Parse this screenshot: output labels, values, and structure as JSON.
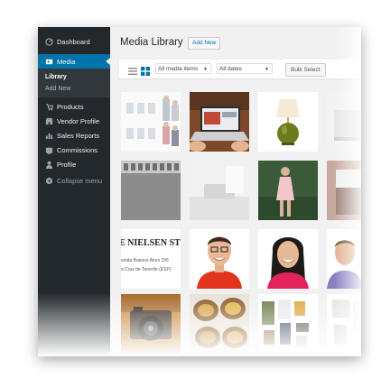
{
  "sidebar": {
    "items": [
      {
        "label": "Dashboard",
        "icon": "dashboard-icon"
      },
      {
        "label": "Media",
        "icon": "media-icon"
      },
      {
        "label": "Products",
        "icon": "products-icon"
      },
      {
        "label": "Vendor Profile",
        "icon": "vendor-profile-icon"
      },
      {
        "label": "Sales Reports",
        "icon": "sales-reports-icon"
      },
      {
        "label": "Commissions",
        "icon": "commissions-icon"
      },
      {
        "label": "Profile",
        "icon": "profile-icon"
      },
      {
        "label": "Collapse menu",
        "icon": "collapse-icon"
      }
    ],
    "submenu": [
      "Library",
      "Add New"
    ]
  },
  "header": {
    "title": "Media Library",
    "add_new": "Add New"
  },
  "toolbar": {
    "filter_type": "All media items",
    "filter_date": "All dates",
    "bulk_select": "Bulk Select"
  },
  "nielsen": {
    "brand": "E NIELSEN STO",
    "line1": "enida Buenos Aires 156",
    "line2": "a Cruz de Tenerife (ESP)"
  },
  "colors": {
    "sidebar": "#23282d",
    "active": "#0073aa",
    "background": "#f1f1f1"
  }
}
